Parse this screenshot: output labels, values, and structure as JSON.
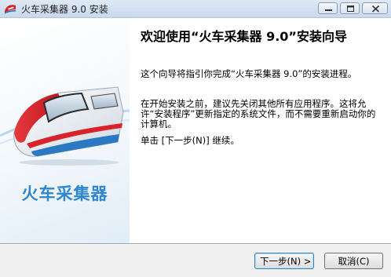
{
  "window": {
    "title": "火车采集器 9.0 安装"
  },
  "banner": {
    "brand_text": "火车采集器"
  },
  "content": {
    "heading": "欢迎使用“火车采集器 9.0”安装向导",
    "paragraph1": "这个向导将指引你完成“火车采集器 9.0”的安装进程。",
    "paragraph2": "在开始安装之前，建议先关闭其他所有应用程序。这将允许“安装程序”更新指定的系统文件，而不需要重新启动你的计算机。",
    "paragraph3": "单击 [下一步(N)] 继续。"
  },
  "buttons": {
    "next_label": "下一步(N) >",
    "cancel_label": "取消(C)"
  },
  "icons": {
    "app": "train-icon",
    "minimize": "minimize-icon",
    "maximize": "maximize-icon",
    "close": "close-icon"
  },
  "colors": {
    "brand_blue": "#2f86cd",
    "train_red": "#d8232a",
    "titlebar": "#c9d9ed"
  }
}
